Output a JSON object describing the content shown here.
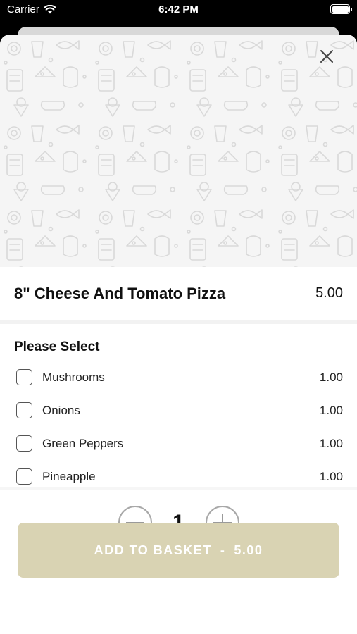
{
  "status_bar": {
    "carrier": "Carrier",
    "time": "6:42 PM",
    "icons": [
      "wifi-icon",
      "battery-icon"
    ]
  },
  "product": {
    "name": "8\" Cheese And Tomato Pizza",
    "price": "5.00"
  },
  "options": {
    "heading": "Please Select",
    "items": [
      {
        "label": "Mushrooms",
        "price": "1.00",
        "checked": false
      },
      {
        "label": "Onions",
        "price": "1.00",
        "checked": false
      },
      {
        "label": "Green Peppers",
        "price": "1.00",
        "checked": false
      },
      {
        "label": "Pineapple",
        "price": "1.00",
        "checked": false
      }
    ]
  },
  "quantity": {
    "value": "1"
  },
  "add_button": {
    "label": "ADD TO BASKET",
    "separator": "-",
    "total": "5.00"
  },
  "colors": {
    "accent_button": "#d9d3b3",
    "hero_background": "#f5f5f5",
    "status_bar": "#000000"
  }
}
